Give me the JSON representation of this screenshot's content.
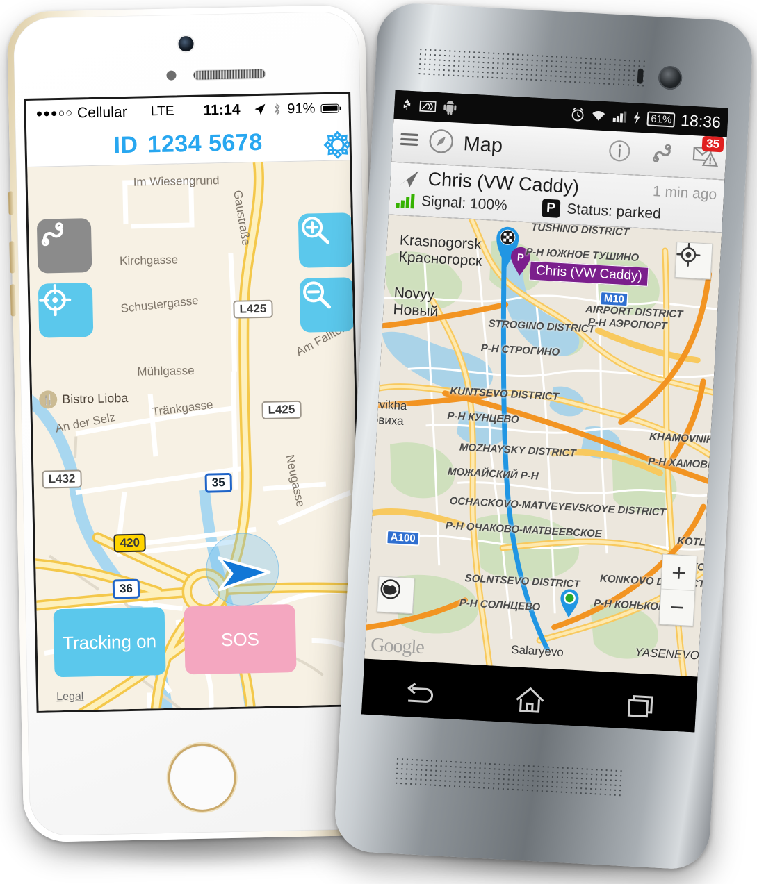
{
  "iphone": {
    "status": {
      "signal_dots": "●●●○○",
      "carrier": "Cellular",
      "network": "LTE",
      "time": "11:14",
      "battery_percent": "91%",
      "location_icon": "location-arrow-icon",
      "bluetooth_icon": "bluetooth-icon"
    },
    "navbar": {
      "label": "ID",
      "device_id": "1234 5678",
      "settings_icon": "gear-icon",
      "accent_color": "#28a7f0"
    },
    "map": {
      "labels": [
        "Im Wiesengrund",
        "Gaustraße",
        "Kirchgasse",
        "Schustergasse",
        "Mühlgasse",
        "Am Falltor",
        "An der Selz",
        "Tränkgasse",
        "Neugasse"
      ],
      "poi": {
        "name": "Bistro Lioba",
        "icon": "restaurant-icon"
      },
      "shields": [
        {
          "text": "L425",
          "style": "white"
        },
        {
          "text": "L425",
          "style": "white"
        },
        {
          "text": "L432",
          "style": "white"
        },
        {
          "text": "35",
          "style": "blue"
        },
        {
          "text": "36",
          "style": "blue"
        },
        {
          "text": "420",
          "style": "yellow"
        }
      ],
      "controls": {
        "route_icon": "route-track-icon",
        "center_icon": "crosshair-target-icon",
        "zoom_in_icon": "magnifier-plus-icon",
        "zoom_out_icon": "magnifier-minus-icon"
      },
      "position_marker": "blue-direction-arrow"
    },
    "actions": {
      "tracking_label": "Tracking on",
      "tracking_color": "#5bc8ec",
      "sos_label": "SOS",
      "sos_color": "#f4a7c0",
      "legal_label": "Legal"
    }
  },
  "android": {
    "status": {
      "usb_icon": "usb-icon",
      "nfc_icon": "nfc-icon",
      "android_icon": "android-robot-icon",
      "alarm_icon": "alarm-clock-icon",
      "wifi_icon": "wifi-icon",
      "signal_icon": "cell-signal-icon",
      "charging_icon": "charging-bolt-icon",
      "battery_percent": "61%",
      "time": "18:36"
    },
    "actionbar": {
      "menu_icon": "hamburger-menu-icon",
      "app_icon": "compass-icon",
      "title": "Map",
      "info_icon": "info-icon",
      "track_icon": "route-track-icon",
      "message_icon": "message-warning-icon",
      "message_badge": "35",
      "badge_color": "#e02020"
    },
    "info_panel": {
      "arrow_icon": "direction-arrow-icon",
      "name": "Chris (VW Caddy)",
      "timestamp": "1 min ago",
      "signal_icon": "signal-bars-icon",
      "signal_label": "Signal: 100%",
      "parking_icon": "parking-icon",
      "status_label": "Status: parked"
    },
    "map": {
      "marker_label": "Chris (VW Caddy)",
      "marker_color": "#7b1f8c",
      "route_color": "#2196e3",
      "cities": [
        {
          "latin": "Krasnogorsk",
          "cyrillic": "Красногорск"
        },
        {
          "latin": "Novyy",
          "cyrillic": "Новый"
        }
      ],
      "districts": [
        {
          "latin": "TUSHINO DISTRICT",
          "cyrillic": "Р-Н ЮЖНОЕ ТУШИНО"
        },
        {
          "latin": "STROGINO DISTRICT",
          "cyrillic": "Р-Н СТРОГИНО"
        },
        {
          "latin": "AIRPORT DISTRICT",
          "cyrillic": "Р-Н АЭРОПОРТ"
        },
        {
          "latin": "KUNTSEVO DISTRICT",
          "cyrillic": "Р-Н КУНЦЕВО"
        },
        {
          "latin": "MOZHAYSKY DISTRICT",
          "cyrillic": "МОЖАЙСКИЙ Р-Н"
        },
        {
          "latin": "KHAMOVNIKI DISTRICT",
          "cyrillic": "Р-Н ХАМОВНИ"
        },
        {
          "latin": "OCHACKOVO-MATVEYEVSKOYE DISTRICT",
          "cyrillic": "Р-Н ОЧАКОВО-МАТВЕЕВСКОЕ"
        },
        {
          "latin": "SOLNTSEVO DISTRICT",
          "cyrillic": "Р-Н СОЛНЦЕВО"
        },
        {
          "latin": "KONKOVO DISTRICT",
          "cyrillic": "Р-Н КОНЬКОВО"
        },
        {
          "latin": "KOTL",
          "cyrillic": "Р-Н КОТ"
        }
      ],
      "towns": [
        "Salaryevo",
        "YASENEVO",
        "rvikha",
        "рвиха"
      ],
      "shields": [
        "M10",
        "A100"
      ],
      "my_location_icon": "my-location-icon",
      "layers_icon": "globe-layers-icon",
      "zoom_in_label": "+",
      "zoom_out_label": "−",
      "attribution": "Google"
    },
    "navbar": {
      "back_icon": "back-arrow-icon",
      "home_icon": "home-icon",
      "recents_icon": "recents-icon"
    }
  }
}
